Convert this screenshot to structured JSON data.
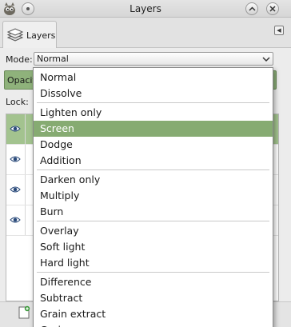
{
  "window": {
    "title": "Layers"
  },
  "tab": {
    "label": "Layers"
  },
  "mode": {
    "label": "Mode:",
    "value": "Normal"
  },
  "opacity": {
    "label": "Opacity"
  },
  "lock": {
    "label": "Lock:"
  },
  "layers": {
    "visible": [
      true,
      true,
      true,
      true
    ],
    "selected_index": 0
  },
  "dropdown": {
    "selected_index": 3,
    "groups": [
      [
        "Normal",
        "Dissolve"
      ],
      [
        "Lighten only",
        "Screen",
        "Dodge",
        "Addition"
      ],
      [
        "Darken only",
        "Multiply",
        "Burn"
      ],
      [
        "Overlay",
        "Soft light",
        "Hard light"
      ],
      [
        "Difference",
        "Subtract",
        "Grain extract",
        "Grain merge"
      ]
    ]
  },
  "colors": {
    "accent_green": "#86ab72",
    "selected_row_green": "#a3c38f",
    "opacity_bar": "#8fb27b"
  },
  "icons": {
    "app": "gimp-wilber-icon",
    "pin": "pin-icon",
    "minimize": "minimize-chevron-icon",
    "close": "close-icon",
    "layers_tab": "layers-stack-icon",
    "tab_menu": "tab-menu-arrow-icon",
    "visibility": "eye-icon",
    "new_layer": "new-layer-icon"
  }
}
